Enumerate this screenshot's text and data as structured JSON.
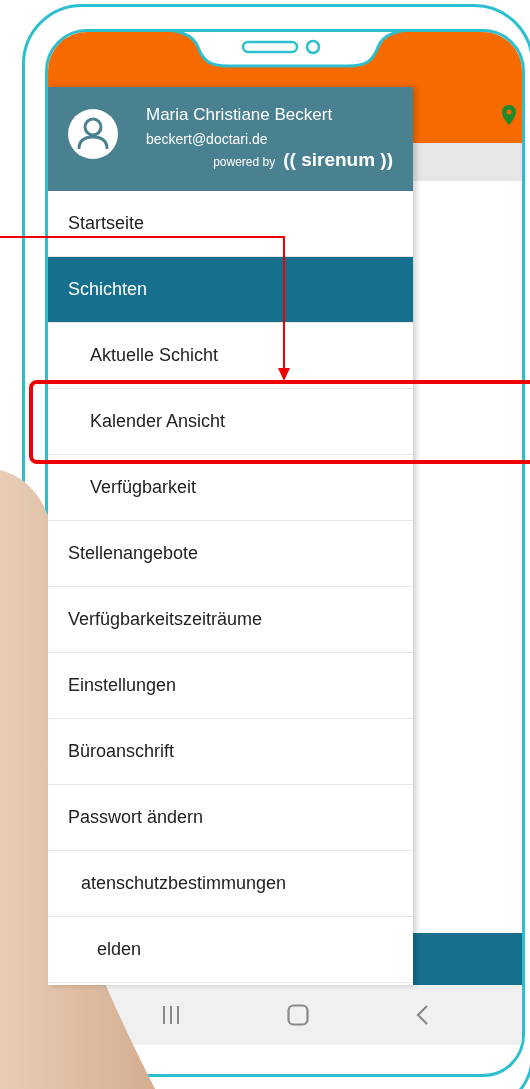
{
  "drawer": {
    "user_name": "Maria Christiane Beckert",
    "email": "beckert@doctari.de",
    "powered_by": "powered by",
    "brand": "(( sirenum ))",
    "items": [
      {
        "label": "Startseite",
        "selected": false
      },
      {
        "label": "Schichten",
        "selected": true,
        "children": [
          {
            "label": "Aktuelle Schicht",
            "selected": false
          },
          {
            "label": "Kalender Ansicht",
            "selected": false
          },
          {
            "label": "Verfügbarkeit",
            "selected": false
          }
        ]
      },
      {
        "label": "Stellenangebote",
        "selected": false
      },
      {
        "label": "Verfügbarkeitszeiträume",
        "selected": false
      },
      {
        "label": "Einstellungen",
        "selected": false
      },
      {
        "label": "Büroanschrift",
        "selected": false
      },
      {
        "label": "Passwort ändern",
        "selected": false
      },
      {
        "label": "atenschutzbestimmungen",
        "selected": false
      },
      {
        "label": "elden",
        "selected": false
      }
    ]
  }
}
